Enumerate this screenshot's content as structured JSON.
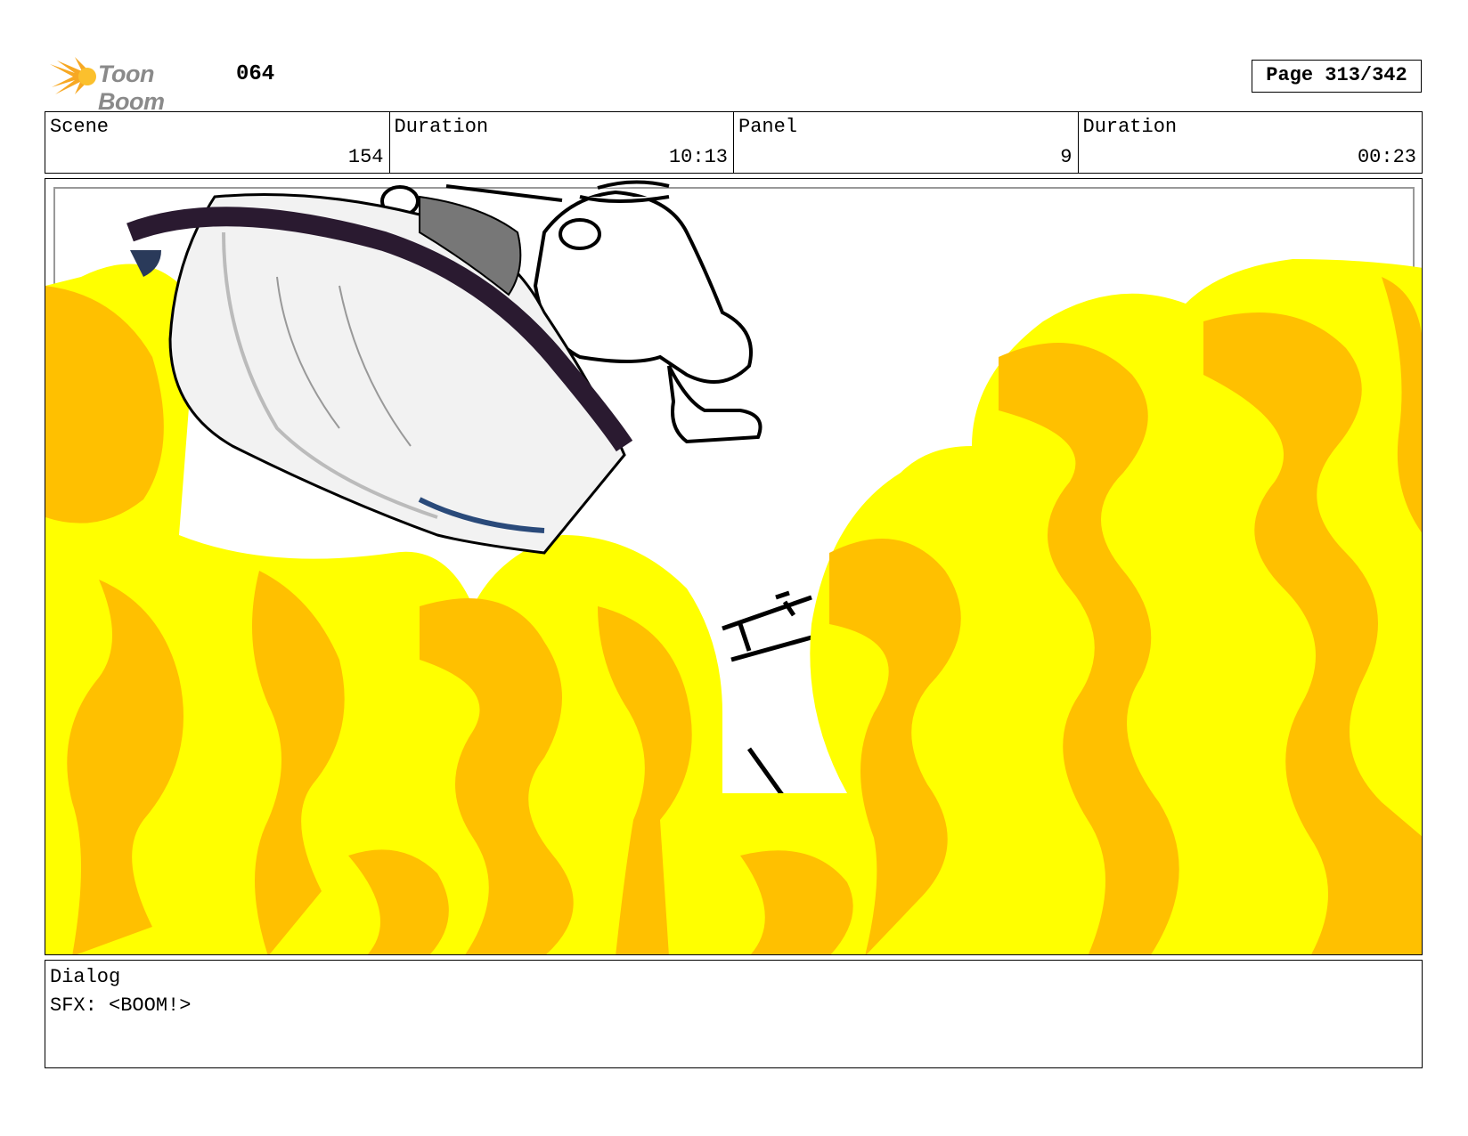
{
  "header": {
    "brand": "Toon Boom",
    "project_code": "064",
    "page": "Page 313/342"
  },
  "info": {
    "scene_label": "Scene",
    "scene_value": "154",
    "duration_label": "Duration",
    "duration_value": "10:13",
    "panel_label": "Panel",
    "panel_value": "9",
    "panel_duration_label": "Duration",
    "panel_duration_value": "00:23"
  },
  "dialog": {
    "label": "Dialog",
    "text": "SFX: <BOOM!>"
  },
  "colors": {
    "fire_yellow": "#ffff00",
    "fire_orange": "#ffc000",
    "logo_orange": "#f7a823"
  },
  "icons": {
    "logo": "toon-boom-logo-icon"
  }
}
